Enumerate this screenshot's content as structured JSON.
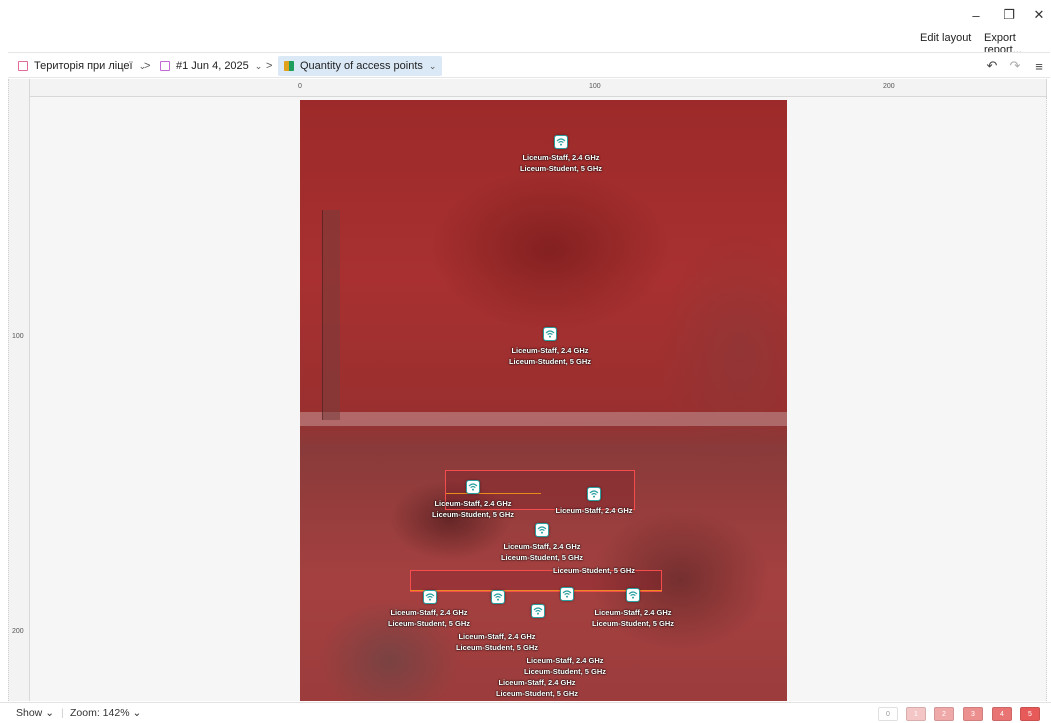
{
  "window": {
    "minimize_glyph": "–",
    "restore_glyph": "❐",
    "close_glyph": "✕"
  },
  "top_actions": {
    "edit_layout": "Edit layout",
    "export_report": "Export report..."
  },
  "breadcrumbs": [
    {
      "label": "Територія при ліцеї",
      "icon": "floor-plan-icon",
      "color": "#e06a9a"
    },
    {
      "label": "#1 Jun 4, 2025",
      "icon": "survey-icon",
      "color": "#c569d8"
    },
    {
      "label": "Quantity of access points",
      "icon": "heatmap-icon",
      "color": "#e0a21b"
    }
  ],
  "toolbar": {
    "undo_icon": "undo-icon",
    "redo_icon": "redo-icon",
    "settings_icon": "settings-sliders-icon"
  },
  "ruler": {
    "h_labels": [
      "0",
      "100",
      "200"
    ],
    "v_labels": [
      "100",
      "200"
    ]
  },
  "access_points": [
    {
      "lines": [
        "Liceum-Staff, 2.4 GHz",
        "Liceum-Student, 5 GHz"
      ]
    },
    {
      "lines": [
        "Liceum-Staff, 2.4 GHz",
        "Liceum-Student, 5 GHz"
      ]
    },
    {
      "lines": [
        "Liceum-Staff, 2.4 GHz",
        "Liceum-Student, 5 GHz"
      ]
    },
    {
      "lines": [
        "Liceum-Staff, 2.4 GHz"
      ]
    },
    {
      "lines": [
        "Liceum-Staff, 2.4 GHz",
        "Liceum-Student, 5 GHz"
      ]
    },
    {
      "lines": [
        "Liceum-Student, 5 GHz"
      ]
    },
    {
      "lines": [
        "Liceum-Staff, 2.4 GHz",
        "Liceum-Student, 5 GHz"
      ]
    },
    {
      "lines": [
        "Liceum-Staff, 2.4 GHz",
        "Liceum-Student, 5 GHz"
      ]
    },
    {
      "lines": [
        "Liceum-Staff, 2.4 GHz",
        "Liceum-Student, 5 GHz"
      ]
    },
    {
      "lines": [
        "Liceum-Staff, 2.4 GHz",
        "Liceum-Student, 5 GHz"
      ]
    },
    {
      "lines": [
        "Liceum-Staff, 2.4 GHz",
        "Liceum-Student, 5 GHz"
      ]
    }
  ],
  "bottom": {
    "show": "Show",
    "zoom": "Zoom: 142%"
  },
  "legend": [
    {
      "label": "0",
      "color": "#ffffff",
      "text_color": "#999999"
    },
    {
      "label": "1",
      "color": "#f5c6c6",
      "text_color": "#ffffff"
    },
    {
      "label": "2",
      "color": "#f0a9a9",
      "text_color": "#ffffff"
    },
    {
      "label": "3",
      "color": "#ec8f8f",
      "text_color": "#ffffff"
    },
    {
      "label": "4",
      "color": "#e97474",
      "text_color": "#ffffff"
    },
    {
      "label": "5",
      "color": "#e65a5a",
      "text_color": "#ffffff"
    }
  ]
}
